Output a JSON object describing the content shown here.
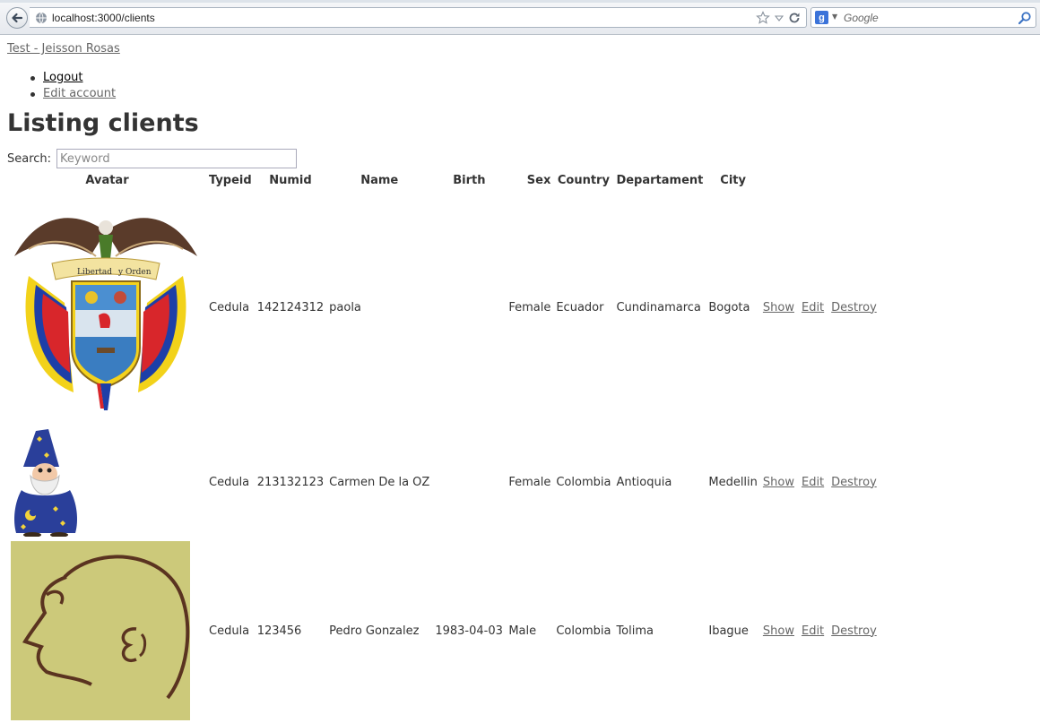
{
  "browser": {
    "url": "localhost:3000/clients",
    "search_engine_placeholder": "Google"
  },
  "header": {
    "brand": "Test - Jeisson Rosas",
    "nav": [
      {
        "label": "Logout"
      },
      {
        "label": "Edit account"
      }
    ]
  },
  "page": {
    "title": "Listing clients",
    "search_label": "Search:",
    "search_placeholder": "Keyword"
  },
  "table": {
    "columns": [
      "Avatar",
      "Typeid",
      "Numid",
      "Name",
      "Birth",
      "Sex",
      "Country",
      "Departament",
      "City"
    ],
    "actions": {
      "show": "Show",
      "edit": "Edit",
      "destroy": "Destroy"
    },
    "rows": [
      {
        "avatar": "colombia-coat-of-arms",
        "typeid": "Cedula",
        "numid": "142124312",
        "name": "paola",
        "birth": "",
        "sex": "Female",
        "country": "Ecuador",
        "departament": "Cundinamarca",
        "city": "Bogota"
      },
      {
        "avatar": "wizard-cartoon",
        "typeid": "Cedula",
        "numid": "213132123",
        "name": "Carmen De la OZ",
        "birth": "",
        "sex": "Female",
        "country": "Colombia",
        "departament": "Antioquia",
        "city": "Medellin"
      },
      {
        "avatar": "face-sketch",
        "typeid": "Cedula",
        "numid": "123456",
        "name": "Pedro Gonzalez",
        "birth": "1983-04-03",
        "sex": "Male",
        "country": "Colombia",
        "departament": "Tolima",
        "city": "Ibague"
      }
    ]
  }
}
